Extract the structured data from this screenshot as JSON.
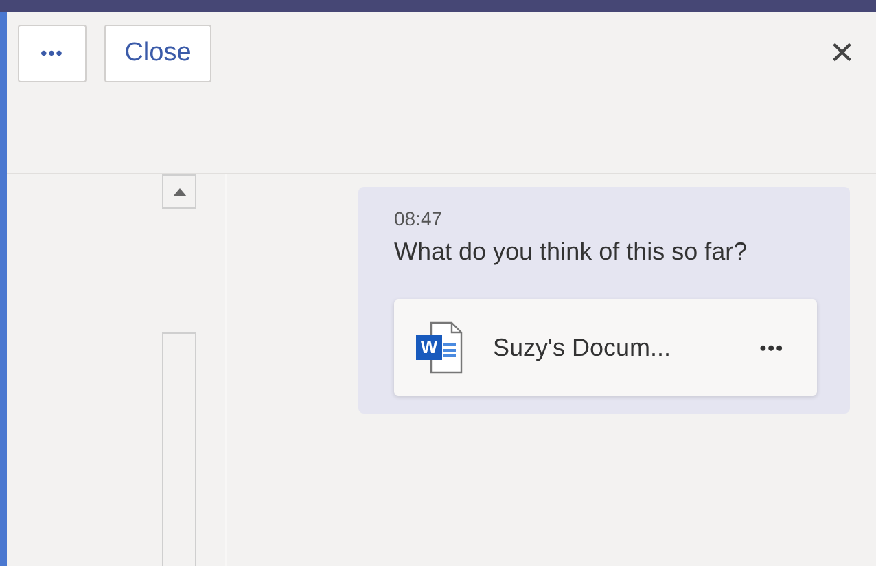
{
  "toolbar": {
    "more_button": "•••",
    "close_button": "Close",
    "dismiss": "×"
  },
  "message": {
    "time": "08:47",
    "text": "What do you think of this so far?",
    "attachment": {
      "icon_letter": "W",
      "name": "Suzy's Docum...",
      "more": "•••"
    }
  }
}
